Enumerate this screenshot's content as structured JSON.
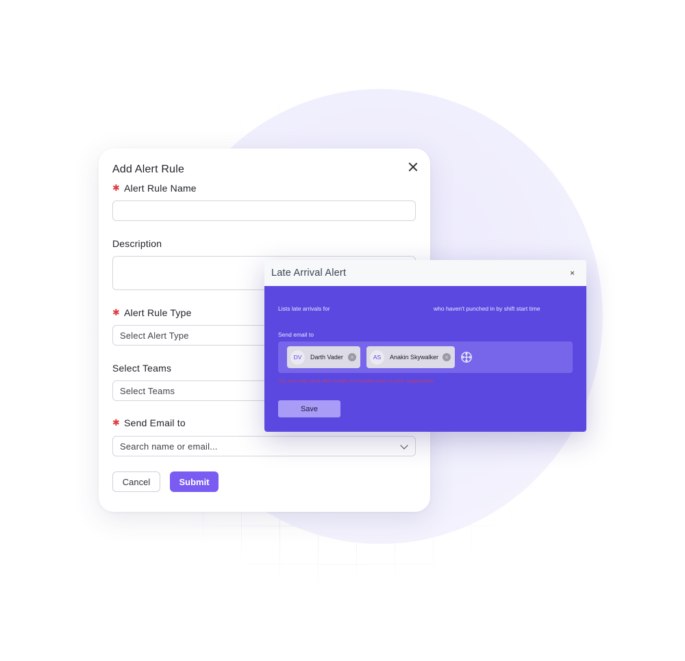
{
  "modal": {
    "title": "Add Alert Rule",
    "fields": {
      "rule_name_label": "Alert Rule Name",
      "rule_name_value": "",
      "description_label": "Description",
      "description_value": "",
      "rule_type_label": "Alert Rule Type",
      "rule_type_placeholder": "Select Alert Type",
      "teams_label": "Select Teams",
      "teams_placeholder": "Select Teams",
      "send_email_label": "Send Email to",
      "send_email_placeholder": "Search name or email..."
    },
    "buttons": {
      "cancel": "Cancel",
      "submit": "Submit"
    }
  },
  "alert_card": {
    "title": "Late Arrival Alert",
    "close_glyph": "×",
    "lists_text": "Lists late arrivals for",
    "suffix_text": "who haven't punched in by shift start time",
    "send_email_label": "Send email to",
    "recipients": [
      {
        "initials": "DV",
        "name": "Darth Vader"
      },
      {
        "initials": "AS",
        "name": "Anakin Skywalker"
      }
    ],
    "warning": "You can only send alert emails to licensed users in your organization",
    "save_label": "Save"
  },
  "colors": {
    "accent": "#7a5cf2",
    "card_body": "#5a48e0",
    "required": "#e0393e"
  },
  "icons": [
    "close-icon",
    "chevron-down-icon",
    "chip-remove-icon",
    "move-icon"
  ]
}
